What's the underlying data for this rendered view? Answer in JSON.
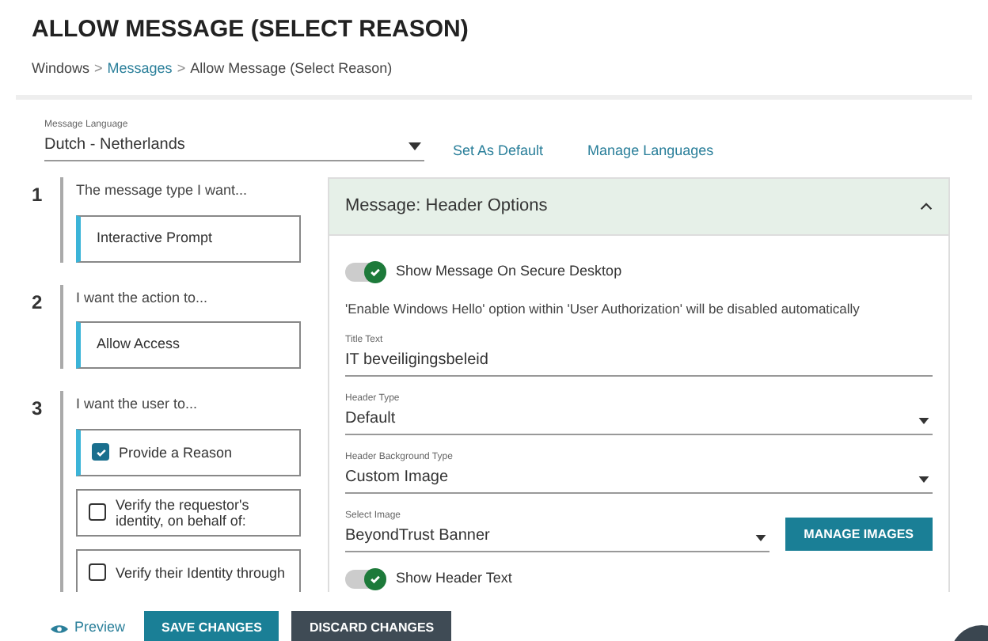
{
  "page_title": "ALLOW MESSAGE (SELECT REASON)",
  "breadcrumb": [
    {
      "label": "Windows",
      "link": false
    },
    {
      "label": "Messages",
      "link": true
    },
    {
      "label": "Allow Message (Select Reason)",
      "link": false
    }
  ],
  "breadcrumb_separator": ">",
  "language": {
    "label": "Message Language",
    "value": "Dutch - Netherlands"
  },
  "language_links": [
    "Set As Default",
    "Manage Languages"
  ],
  "steps": [
    {
      "number": "1",
      "prompt": "The message type I want...",
      "options": [
        {
          "kind": "value",
          "label": "Interactive Prompt"
        }
      ]
    },
    {
      "number": "2",
      "prompt": "I want the action to...",
      "options": [
        {
          "kind": "value",
          "label": "Allow Access"
        }
      ]
    },
    {
      "number": "3",
      "prompt": "I want the user to...",
      "options": [
        {
          "kind": "checkbox",
          "label": "Provide a Reason",
          "checked": true
        },
        {
          "kind": "checkbox",
          "label": "Verify the requestor's identity, on behalf of:",
          "checked": false
        },
        {
          "kind": "checkbox",
          "label": "Verify their Identity through",
          "checked": false
        }
      ]
    }
  ],
  "panel": {
    "title": "Message: Header Options",
    "expanded": true,
    "rows": [
      {
        "kind": "toggle",
        "label": "Show Message On Secure Desktop",
        "on": true
      },
      {
        "kind": "note",
        "text": "'Enable Windows Hello' option within 'User Authorization' will be disabled automatically"
      },
      {
        "kind": "text",
        "label": "Title Text",
        "value": "IT beveiligingsbeleid"
      },
      {
        "kind": "select",
        "label": "Header Type",
        "value": "Default"
      },
      {
        "kind": "select",
        "label": "Header Background Type",
        "value": "Custom Image"
      },
      {
        "kind": "select",
        "label": "Select Image",
        "value": "BeyondTrust Banner",
        "button": "MANAGE IMAGES"
      },
      {
        "kind": "toggle",
        "label": "Show Header Text",
        "on": true
      }
    ]
  },
  "footer": {
    "preview": "Preview",
    "buttons": [
      {
        "label": "SAVE CHANGES",
        "kind": "primary"
      },
      {
        "label": "DISCARD CHANGES",
        "kind": "secondary"
      }
    ]
  }
}
